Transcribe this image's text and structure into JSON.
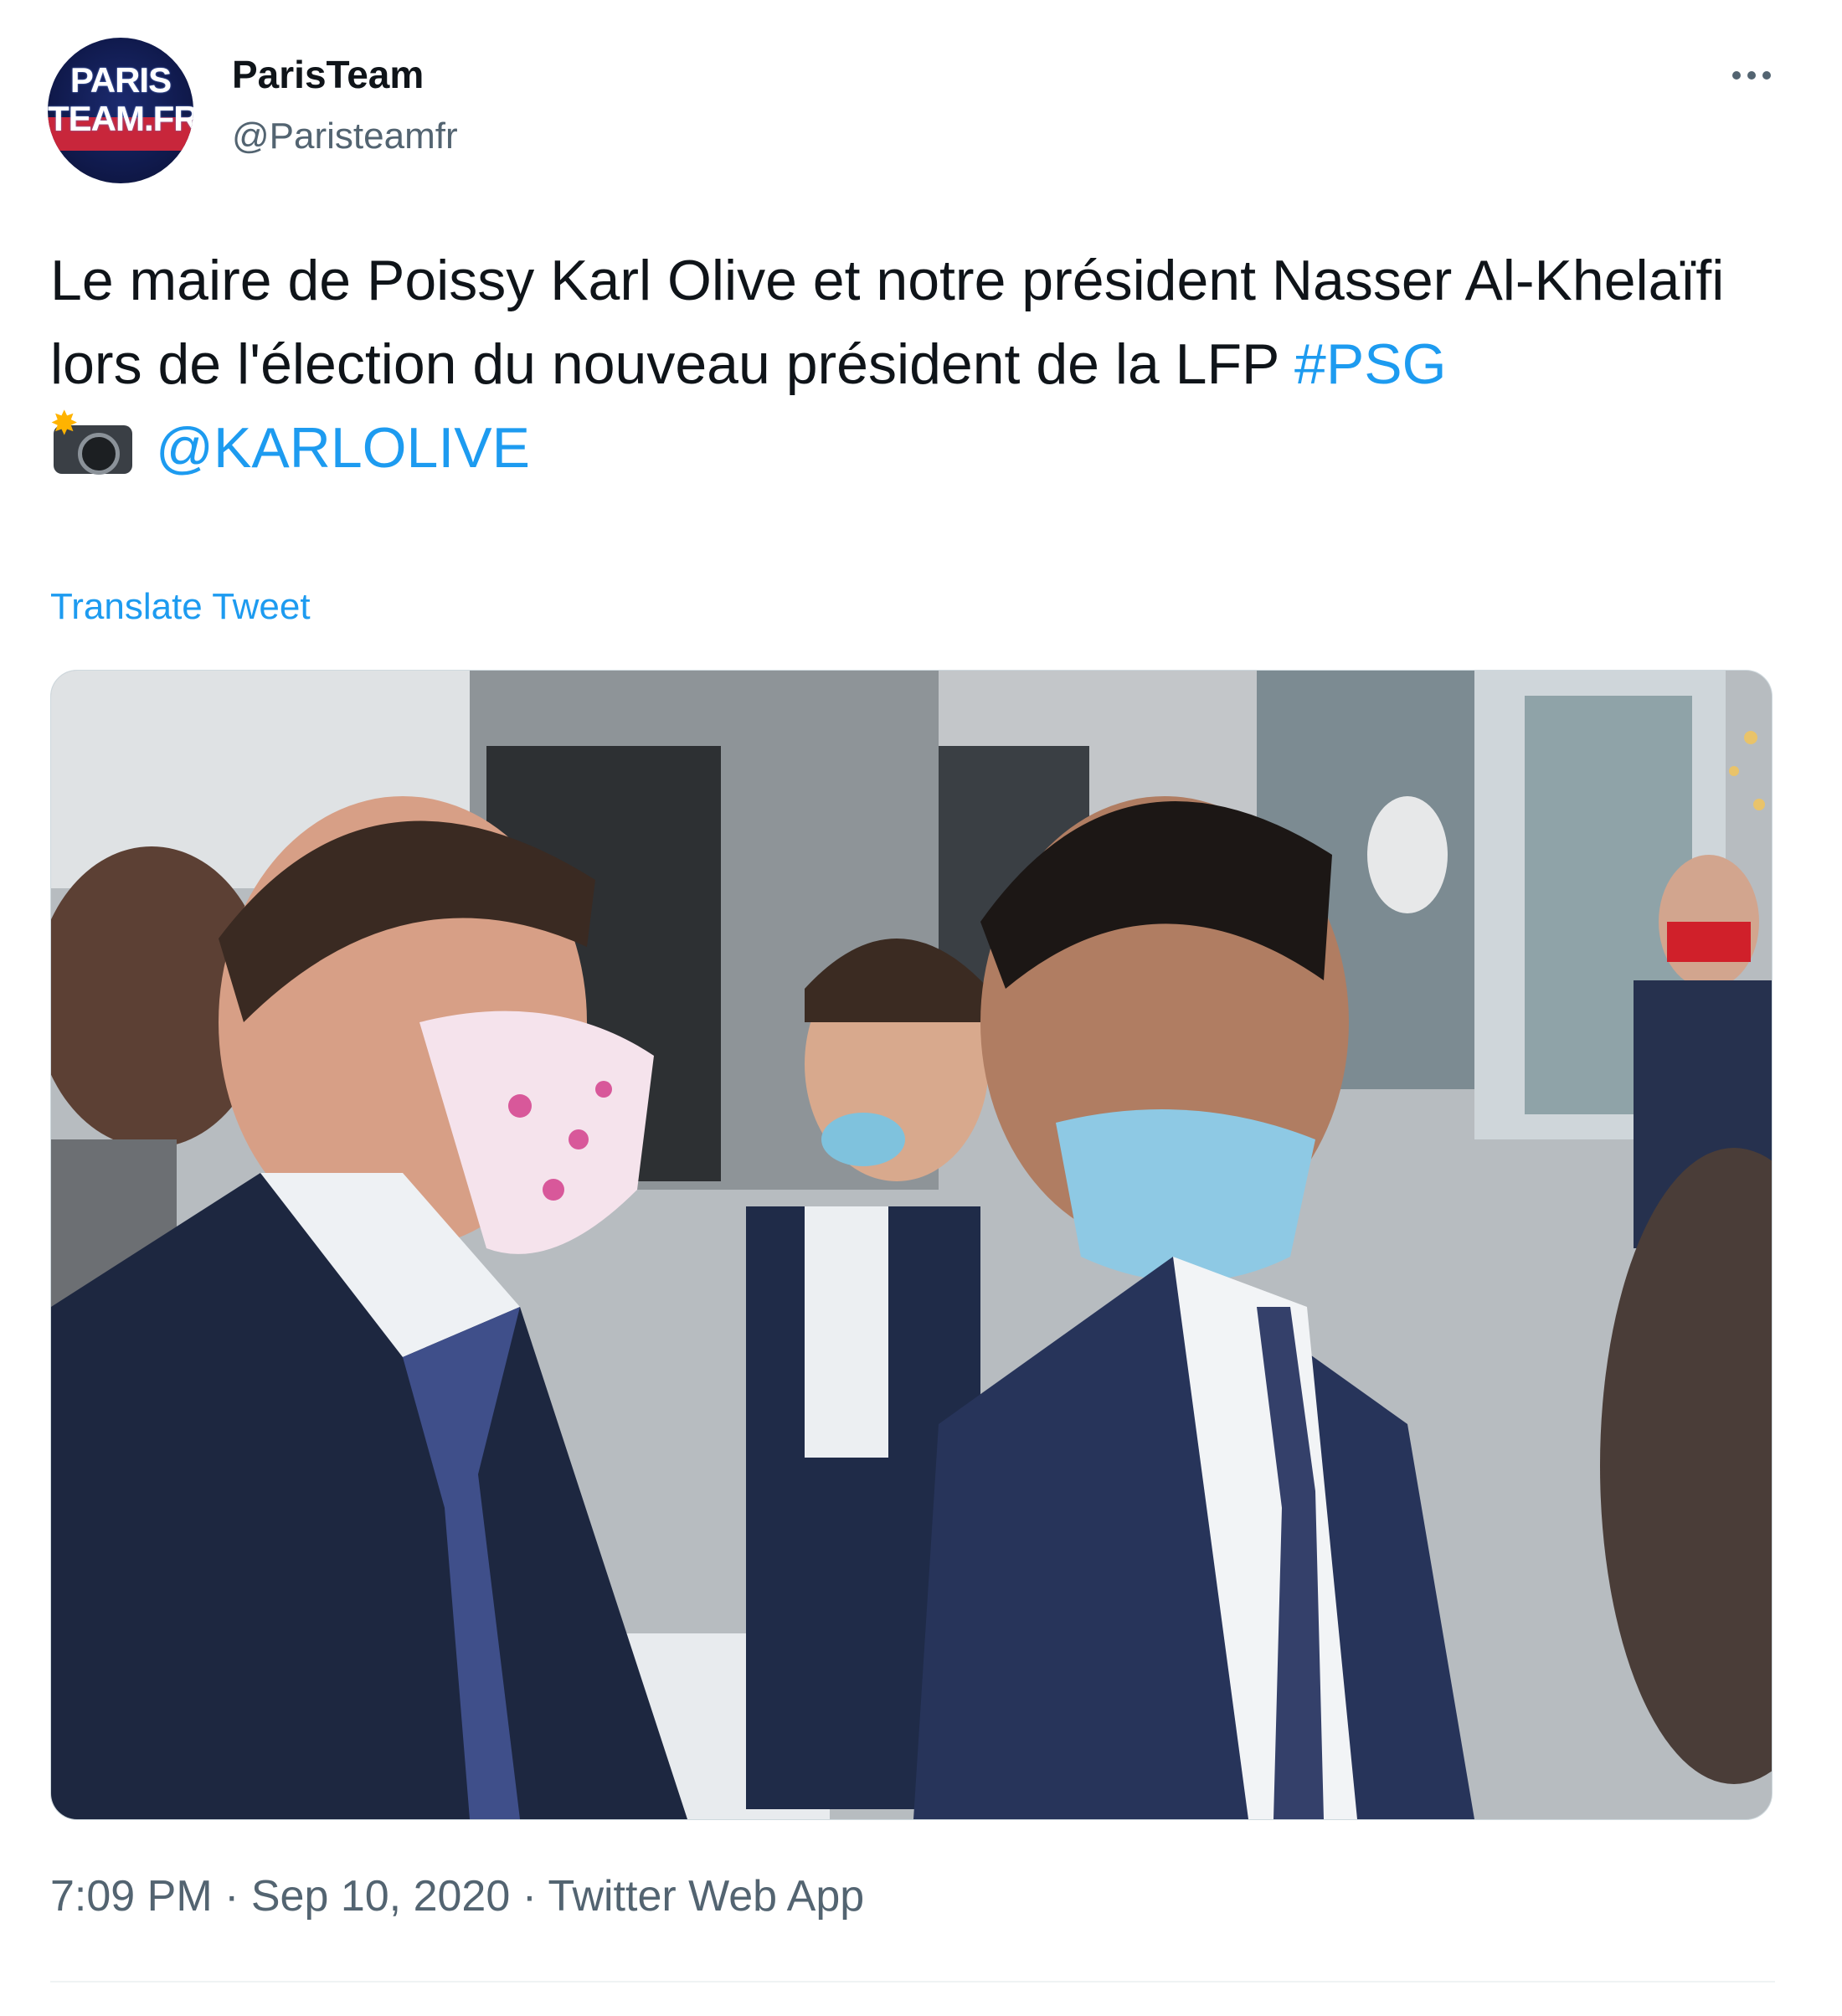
{
  "author": {
    "display_name": "ParisTeam",
    "handle": "@Paristeamfr",
    "avatar_text_line1": "PARIS",
    "avatar_text_line2": "TEAM.FR"
  },
  "tweet": {
    "text_plain": "Le maire de Poissy Karl Olive et notre président Nasser Al-Khelaïfi lors de l'élection du nouveau président de la LFP ",
    "hashtag": "#PSG",
    "mention": "@KARLOLIVE",
    "camera_icon": "camera-flash-icon",
    "translate_label": "Translate Tweet"
  },
  "meta": {
    "time": "7:09 PM",
    "separator": " · ",
    "date": "Sep 10, 2020",
    "source": "Twitter Web App"
  },
  "colors": {
    "link": "#1d9bf0",
    "muted": "#536471",
    "text": "#0f1419"
  }
}
